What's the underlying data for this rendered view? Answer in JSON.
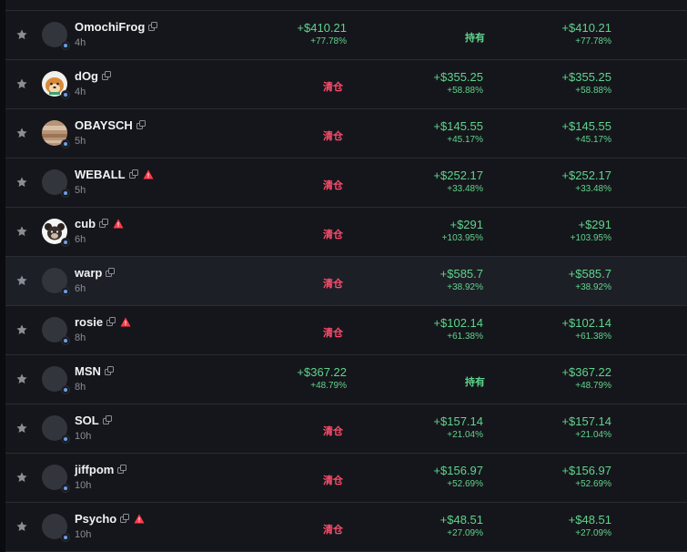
{
  "rows": [
    {
      "name": "OmochiFrog",
      "age": "4h",
      "warn": false,
      "avatar": "none",
      "realized": "+$410.21",
      "realized_pct": "+77.78%",
      "status": "持有",
      "status_type": "hold",
      "unrealized": "",
      "unrealized_pct": "",
      "total": "+$410.21",
      "total_pct": "+77.78%"
    },
    {
      "name": "dOg",
      "age": "4h",
      "warn": false,
      "avatar": "dog",
      "realized": "",
      "realized_pct": "",
      "status": "清仓",
      "status_type": "sold",
      "unrealized": "+$355.25",
      "unrealized_pct": "+58.88%",
      "total": "+$355.25",
      "total_pct": "+58.88%"
    },
    {
      "name": "OBAYSCH",
      "age": "5h",
      "warn": false,
      "avatar": "tan",
      "realized": "",
      "realized_pct": "",
      "status": "清仓",
      "status_type": "sold",
      "unrealized": "+$145.55",
      "unrealized_pct": "+45.17%",
      "total": "+$145.55",
      "total_pct": "+45.17%"
    },
    {
      "name": "WEBALL",
      "age": "5h",
      "warn": true,
      "avatar": "none",
      "realized": "",
      "realized_pct": "",
      "status": "清仓",
      "status_type": "sold",
      "unrealized": "+$252.17",
      "unrealized_pct": "+33.48%",
      "total": "+$252.17",
      "total_pct": "+33.48%"
    },
    {
      "name": "cub",
      "age": "6h",
      "warn": true,
      "avatar": "cub",
      "realized": "",
      "realized_pct": "",
      "status": "清仓",
      "status_type": "sold",
      "unrealized": "+$291",
      "unrealized_pct": "+103.95%",
      "total": "+$291",
      "total_pct": "+103.95%"
    },
    {
      "name": "warp",
      "age": "6h",
      "warn": false,
      "avatar": "none",
      "highlight": true,
      "realized": "",
      "realized_pct": "",
      "status": "清仓",
      "status_type": "sold",
      "unrealized": "+$585.7",
      "unrealized_pct": "+38.92%",
      "total": "+$585.7",
      "total_pct": "+38.92%"
    },
    {
      "name": "rosie",
      "age": "8h",
      "warn": true,
      "avatar": "none",
      "realized": "",
      "realized_pct": "",
      "status": "清仓",
      "status_type": "sold",
      "unrealized": "+$102.14",
      "unrealized_pct": "+61.38%",
      "total": "+$102.14",
      "total_pct": "+61.38%"
    },
    {
      "name": "MSN",
      "age": "8h",
      "warn": false,
      "avatar": "none",
      "realized": "+$367.22",
      "realized_pct": "+48.79%",
      "status": "持有",
      "status_type": "hold",
      "unrealized": "",
      "unrealized_pct": "",
      "total": "+$367.22",
      "total_pct": "+48.79%"
    },
    {
      "name": "SOL",
      "age": "10h",
      "warn": false,
      "avatar": "none",
      "realized": "",
      "realized_pct": "",
      "status": "清仓",
      "status_type": "sold",
      "unrealized": "+$157.14",
      "unrealized_pct": "+21.04%",
      "total": "+$157.14",
      "total_pct": "+21.04%"
    },
    {
      "name": "jiffpom",
      "age": "10h",
      "warn": false,
      "avatar": "none",
      "realized": "",
      "realized_pct": "",
      "status": "清仓",
      "status_type": "sold",
      "unrealized": "+$156.97",
      "unrealized_pct": "+52.69%",
      "total": "+$156.97",
      "total_pct": "+52.69%"
    },
    {
      "name": "Psycho",
      "age": "10h",
      "warn": true,
      "avatar": "none",
      "realized": "",
      "realized_pct": "",
      "status": "清仓",
      "status_type": "sold",
      "unrealized": "+$48.51",
      "unrealized_pct": "+27.09%",
      "total": "+$48.51",
      "total_pct": "+27.09%"
    }
  ],
  "colors": {
    "positive": "#5fd48c",
    "negative": "#ff4d6d",
    "row_bg": "#15161b",
    "row_highlight": "#1d1f26"
  },
  "icons": {
    "favorite": "star-icon",
    "copy": "copy-icon",
    "warning": "warning-icon",
    "chain": "solana-chain-icon"
  }
}
